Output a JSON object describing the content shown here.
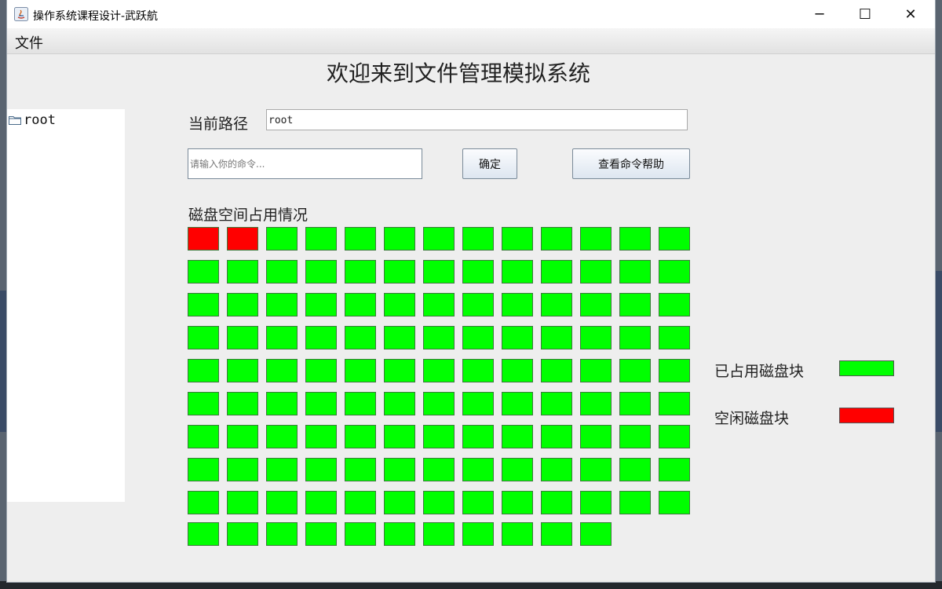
{
  "window": {
    "title": "操作系统课程设计-武跃航",
    "minimize_glyph": "─",
    "maximize_glyph": "☐",
    "close_glyph": "✕"
  },
  "menu": {
    "file_label": "文件"
  },
  "main": {
    "title": "欢迎来到文件管理模拟系统",
    "path_label": "当前路径",
    "path_value": "root",
    "command_placeholder": "请输入你的命令...",
    "ok_button": "确定",
    "help_button": "查看命令帮助",
    "disk_label": "磁盘空间占用情况"
  },
  "tree": {
    "root_label": "root",
    "icon": "folder-icon"
  },
  "legend": {
    "used_label": "已占用磁盘块",
    "free_label": "空闲磁盘块",
    "used_color": "#00ff00",
    "free_color": "#ff0000"
  },
  "disk": {
    "total_blocks": 128,
    "columns": 13,
    "blocks": [
      "red",
      "red",
      "green",
      "green",
      "green",
      "green",
      "green",
      "green",
      "green",
      "green",
      "green",
      "green",
      "green",
      "green",
      "green",
      "green",
      "green",
      "green",
      "green",
      "green",
      "green",
      "green",
      "green",
      "green",
      "green",
      "green",
      "green",
      "green",
      "green",
      "green",
      "green",
      "green",
      "green",
      "green",
      "green",
      "green",
      "green",
      "green",
      "green",
      "green",
      "green",
      "green",
      "green",
      "green",
      "green",
      "green",
      "green",
      "green",
      "green",
      "green",
      "green",
      "green",
      "green",
      "green",
      "green",
      "green",
      "green",
      "green",
      "green",
      "green",
      "green",
      "green",
      "green",
      "green",
      "green",
      "green",
      "green",
      "green",
      "green",
      "green",
      "green",
      "green",
      "green",
      "green",
      "green",
      "green",
      "green",
      "green",
      "green",
      "green",
      "green",
      "green",
      "green",
      "green",
      "green",
      "green",
      "green",
      "green",
      "green",
      "green",
      "green",
      "green",
      "green",
      "green",
      "green",
      "green",
      "green",
      "green",
      "green",
      "green",
      "green",
      "green",
      "green",
      "green",
      "green",
      "green",
      "green",
      "green",
      "green",
      "green",
      "green",
      "green",
      "green",
      "green",
      "green",
      "green",
      "green",
      "green",
      "green",
      "green",
      "green",
      "green",
      "green",
      "green",
      "green",
      "green",
      "green",
      "green"
    ],
    "colors": {
      "red": "#ff0000",
      "green": "#00ff00"
    }
  }
}
